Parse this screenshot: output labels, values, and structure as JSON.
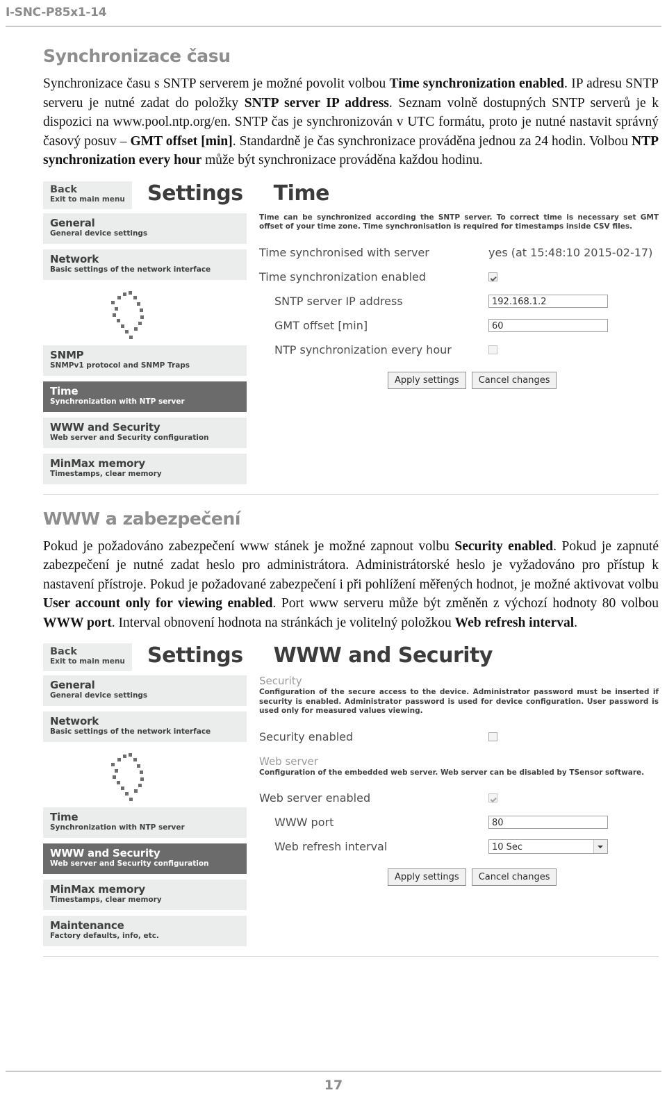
{
  "header": {
    "document_code": "I-SNC-P85x1-14"
  },
  "footer": {
    "page_number": "17"
  },
  "sections": [
    {
      "title": "Synchronizace času",
      "paragraph_html": "Synchronizace času s SNTP serverem je možné povolit volbou <b>Time synchronization enabled</b>. IP adresu SNTP serveru je nutné zadat do položky <b>SNTP server IP address</b>. Seznam volně dostupných SNTP serverů je k dispozici na www.pool.ntp.org/en. SNTP čas je synchronizován v UTC formátu, proto je nutné nastavit správný časový posuv – <b>GMT offset [min]</b>. Standardně je čas synchronizace prováděna jednou za 24 hodin. Volbou <b>NTP synchronization every hour</b> může být synchronizace prováděna každou hodinu."
    },
    {
      "title": "WWW a zabezpečení",
      "paragraph_html": "Pokud je požadováno zabezpečení www stánek je možné zapnout volbu <b>Security enabled</b>. Pokud je zapnuté zabezpečení je nutné zadat heslo pro administrátora. Administrátorské heslo je vyžadováno pro přístup k nastavení přístroje. Pokud je požadované zabezpečení i při pohlížení měřených hodnot, je možné aktivovat volbu <b>User account only for viewing enabled</b>. Port www serveru může být změněn z výchozí hodnoty 80 volbou <b>WWW port</b>. Interval obnovení hodnota na stránkách je volitelný položkou <b>Web refresh interval</b>."
    }
  ],
  "screenshot_time": {
    "back_button": {
      "title": "Back",
      "subtitle": "Exit to main menu"
    },
    "app_title": "Settings",
    "page_title": "Time",
    "nav_items": [
      {
        "title": "General",
        "subtitle": "General device settings",
        "active": false
      },
      {
        "title": "Network",
        "subtitle": "Basic settings of the network interface",
        "active": false
      },
      {
        "title": "SNMP",
        "subtitle": "SNMPv1 protocol and SNMP Traps",
        "active": false
      },
      {
        "title": "Time",
        "subtitle": "Synchronization with NTP server",
        "active": true
      },
      {
        "title": "WWW and Security",
        "subtitle": "Web server and Security configuration",
        "active": false
      },
      {
        "title": "MinMax memory",
        "subtitle": "Timestamps, clear memory",
        "active": false
      }
    ],
    "description": "Time can be synchronized according the SNTP server. To correct time is necessary set GMT offset of your time zone. Time synchronisation is required for timestamps inside CSV files.",
    "fields": {
      "sync_status_label": "Time synchronised with server",
      "sync_status_value": "yes (at 15:48:10 2015-02-17)",
      "sync_enabled_label": "Time synchronization enabled",
      "sync_enabled_checked": "true",
      "sntp_ip_label": "SNTP server IP address",
      "sntp_ip_value": "192.168.1.2",
      "gmt_offset_label": "GMT offset [min]",
      "gmt_offset_value": "60",
      "ntp_hourly_label": "NTP synchronization every hour",
      "ntp_hourly_checked": "false"
    },
    "buttons": {
      "apply": "Apply settings",
      "cancel": "Cancel changes"
    }
  },
  "screenshot_www": {
    "back_button": {
      "title": "Back",
      "subtitle": "Exit to main menu"
    },
    "app_title": "Settings",
    "page_title": "WWW and Security",
    "nav_items": [
      {
        "title": "General",
        "subtitle": "General device settings",
        "active": false
      },
      {
        "title": "Network",
        "subtitle": "Basic settings of the network interface",
        "active": false
      },
      {
        "title": "Time",
        "subtitle": "Synchronization with NTP server",
        "active": false
      },
      {
        "title": "WWW and Security",
        "subtitle": "Web server and Security configuration",
        "active": true
      },
      {
        "title": "MinMax memory",
        "subtitle": "Timestamps, clear memory",
        "active": false
      },
      {
        "title": "Maintenance",
        "subtitle": "Factory defaults, info, etc.",
        "active": false
      }
    ],
    "security_group_title": "Security",
    "security_description": "Configuration of the secure access to the device. Administrator password must be inserted if security is enabled. Administrator password is used for device configuration. User password is used only for measured values viewing.",
    "security_enabled_label": "Security enabled",
    "security_enabled_checked": "false",
    "webserver_group_title": "Web server",
    "webserver_description": "Configuration of the embedded web server. Web server can be disabled by TSensor software.",
    "webserver_enabled_label": "Web server enabled",
    "webserver_enabled_checked": "true",
    "www_port_label": "WWW port",
    "www_port_value": "80",
    "refresh_label": "Web refresh interval",
    "refresh_value": "10 Sec",
    "buttons": {
      "apply": "Apply settings",
      "cancel": "Cancel changes"
    }
  }
}
